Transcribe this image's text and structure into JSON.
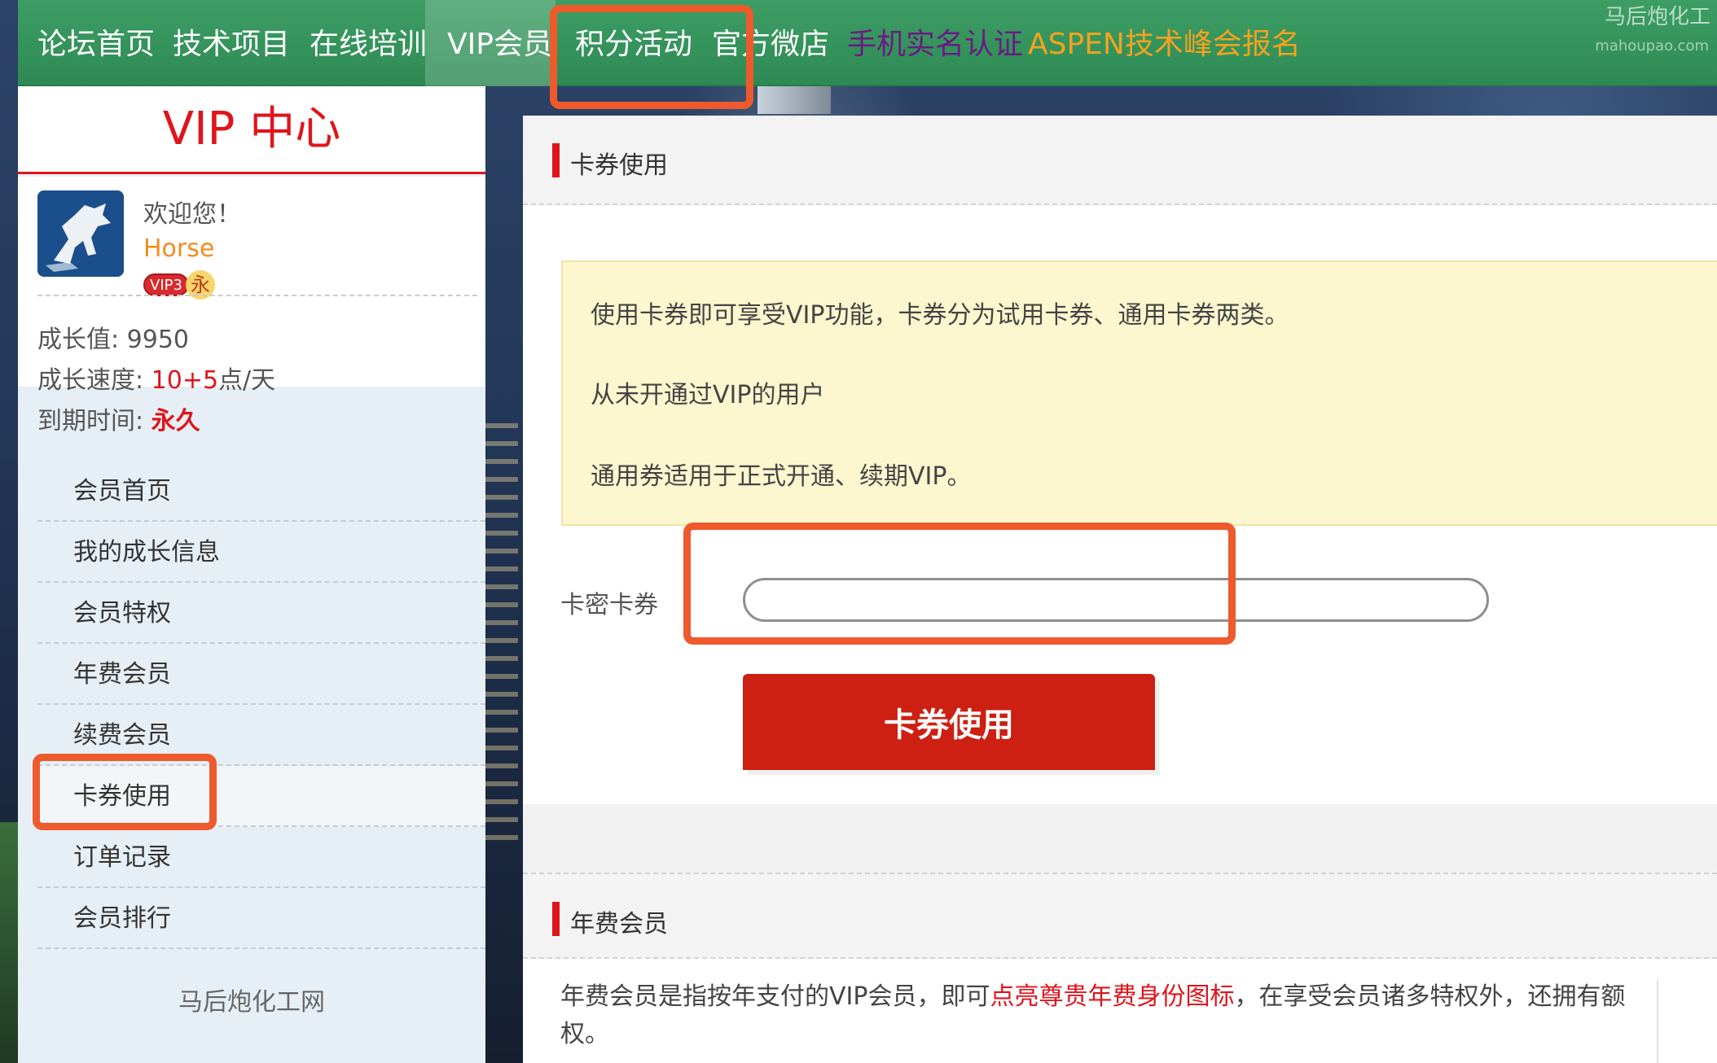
{
  "nav": {
    "items": [
      {
        "label": "论坛首页"
      },
      {
        "label": "技术项目"
      },
      {
        "label": "在线培训"
      },
      {
        "label": "VIP会员"
      },
      {
        "label": "积分活动"
      },
      {
        "label": "官方微店"
      },
      {
        "label": "手机实名认证"
      },
      {
        "label": "ASPEN技术峰会报名"
      }
    ],
    "watermark": "马后炮化工",
    "watermark_url": "mahoupao.com"
  },
  "sidebar": {
    "title": "VIP 中心",
    "user": {
      "welcome": "欢迎您！",
      "name": "Horse",
      "vip_badge": "VIP3",
      "permanent_badge": "永"
    },
    "stats": {
      "growth_label": "成长值: ",
      "growth_value": "9950",
      "speed_label": "成长速度: ",
      "speed_value": "10+5",
      "speed_unit": "点/天",
      "expire_label": "到期时间: ",
      "expire_value": "永久"
    },
    "menu": [
      {
        "label": "会员首页"
      },
      {
        "label": "我的成长信息"
      },
      {
        "label": "会员特权"
      },
      {
        "label": "年费会员"
      },
      {
        "label": "续费会员"
      },
      {
        "label": "卡券使用"
      },
      {
        "label": "订单记录"
      },
      {
        "label": "会员排行"
      }
    ],
    "footer": "马后炮化工网"
  },
  "main": {
    "section_title": "卡券使用",
    "notice": {
      "line1": "使用卡券即可享受VIP功能，卡券分为试用卡券、通用卡券两类。",
      "line2": "从未开通过VIP的用户",
      "line3": "通用券适用于正式开通、续期VIP。"
    },
    "card_label": "卡密卡券",
    "card_input_value": "",
    "redeem_button": "卡券使用",
    "annual_title": "年费会员",
    "annual_desc_pre": "年费会员是指按年支付的VIP会员，即可",
    "annual_desc_highlight": "点亮尊贵年费身份图标",
    "annual_desc_post": "，在享受会员诸多特权外，还拥有额",
    "annual_desc_line2": "权。"
  },
  "colors": {
    "nav_green": "#3d9e64",
    "accent_red": "#e0141b",
    "button_red": "#cd1f12",
    "highlight_orange": "#ee5a2c",
    "notice_yellow": "#fdf7cf"
  }
}
